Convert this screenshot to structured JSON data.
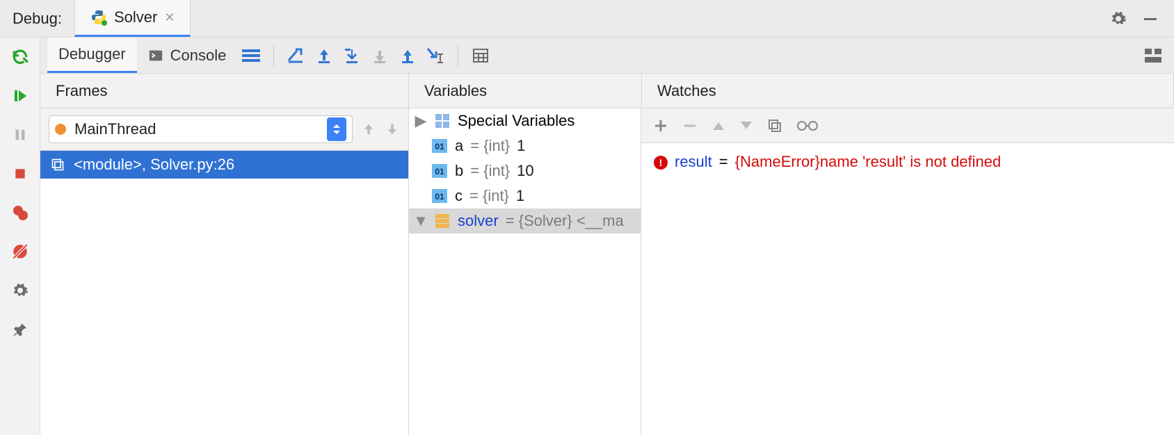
{
  "titlebar": {
    "label": "Debug:"
  },
  "runconfig": {
    "name": "Solver"
  },
  "subtabs": {
    "debugger": "Debugger",
    "console": "Console"
  },
  "panels": {
    "frames": "Frames",
    "variables": "Variables",
    "watches": "Watches"
  },
  "thread": {
    "name": "MainThread"
  },
  "frames_list": [
    {
      "label": "<module>, Solver.py:26"
    }
  ],
  "variables": {
    "special": "Special Variables",
    "items": [
      {
        "name": "a",
        "type": "{int}",
        "value": "1"
      },
      {
        "name": "b",
        "type": "{int}",
        "value": "10"
      },
      {
        "name": "c",
        "type": "{int}",
        "value": "1"
      }
    ],
    "object": {
      "name": "solver",
      "display": "{Solver} <__ma"
    }
  },
  "watches": {
    "item": {
      "name": "result",
      "error": "{NameError}name 'result' is not defined"
    }
  }
}
